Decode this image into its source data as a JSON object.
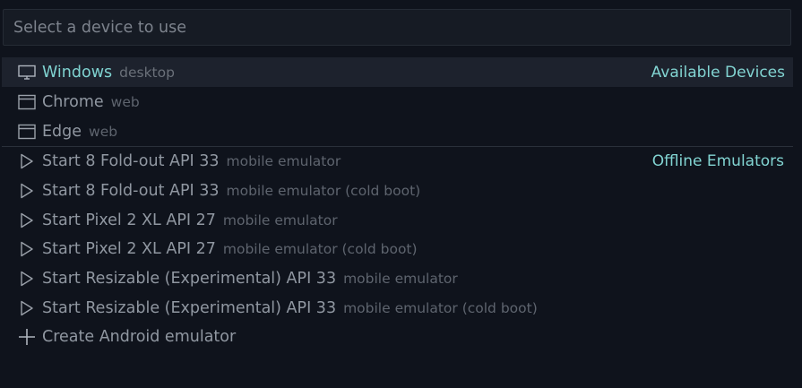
{
  "search": {
    "placeholder": "Select a device to use",
    "value": ""
  },
  "groups": {
    "available": "Available Devices",
    "offline": "Offline Emulators"
  },
  "devices": [
    {
      "label": "Windows",
      "desc": "desktop",
      "icon": "monitor-icon"
    },
    {
      "label": "Chrome",
      "desc": "web",
      "icon": "browser-window-icon"
    },
    {
      "label": "Edge",
      "desc": "web",
      "icon": "browser-window-icon"
    }
  ],
  "emulators": [
    {
      "label": "Start 8  Fold-out API 33",
      "desc": "mobile emulator",
      "icon": "play-icon"
    },
    {
      "label": "Start 8  Fold-out API 33",
      "desc": "mobile emulator (cold boot)",
      "icon": "play-icon"
    },
    {
      "label": "Start Pixel 2 XL API 27",
      "desc": "mobile emulator",
      "icon": "play-icon"
    },
    {
      "label": "Start Pixel 2 XL API 27",
      "desc": "mobile emulator (cold boot)",
      "icon": "play-icon"
    },
    {
      "label": "Start Resizable (Experimental) API 33",
      "desc": "mobile emulator",
      "icon": "play-icon"
    },
    {
      "label": "Start Resizable (Experimental) API 33",
      "desc": "mobile emulator (cold boot)",
      "icon": "play-icon"
    }
  ],
  "create": {
    "label": "Create Android emulator",
    "icon": "plus-icon"
  },
  "colors": {
    "background": "#0f131c",
    "selected_row": "#1d222d",
    "accent": "#7fd2d0",
    "label": "#9097a1",
    "description": "#5e646e"
  }
}
